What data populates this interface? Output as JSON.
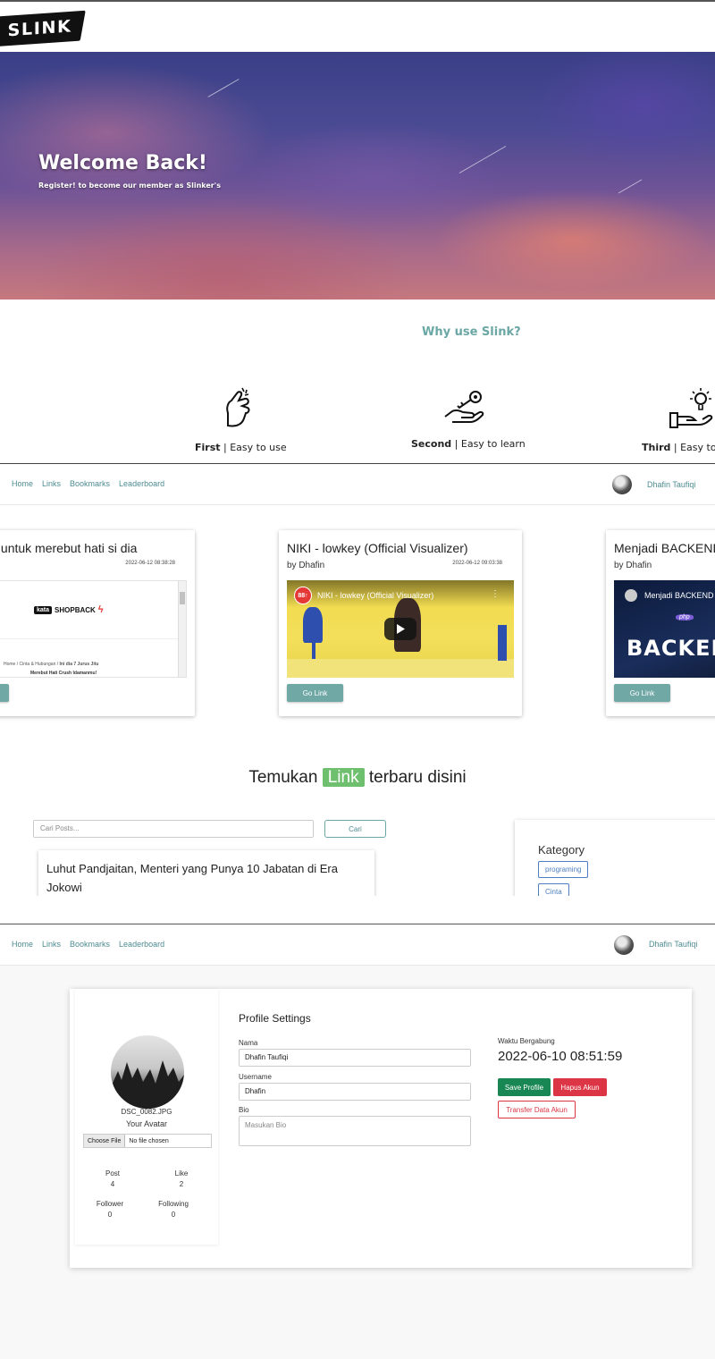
{
  "landing": {
    "logo_text": "SLINK",
    "hero": {
      "title": "Welcome Back!",
      "subtitle": "Register! to become our member as Slinker's"
    },
    "why": {
      "title": "Why use Slink?",
      "features": [
        {
          "rank": "First",
          "text": "| Easy to use",
          "icon": "hand-snap-icon"
        },
        {
          "rank": "Second",
          "text": "| Easy to learn",
          "icon": "hand-key-icon"
        },
        {
          "rank": "Third",
          "text": "| Easy to a",
          "icon": "hand-lightbulb-icon"
        }
      ]
    }
  },
  "navbar": {
    "items": [
      "Home",
      "Links",
      "Bookmarks",
      "Leaderboard"
    ],
    "user_name": "Dhafin Taufiqi"
  },
  "links": {
    "cards": [
      {
        "title": "terbaik untuk merebut hati si dia",
        "date": "2022-06-12 08:38:28",
        "author": "",
        "preview": {
          "brand": "SHOPBACK",
          "logo_text": "kata",
          "breadcrumb": "Home  /  Cinta & Hubungan  /",
          "breadcrumb_bold": "Ini dia 7 Jurus Jitu",
          "breadcrumb_line2": "Merebut Hati Crush Idamanmu!"
        }
      },
      {
        "title": "NIKI - lowkey (Official Visualizer)",
        "date": "2022-06-12 09:03:38",
        "author": "by Dhafin",
        "preview": {
          "video_title": "NIKI - lowkey (Official Visualizer)",
          "channel_badge": "88↑"
        }
      },
      {
        "title": "Menjadi BACKEND",
        "date": "",
        "author": "by Dhafin",
        "preview": {
          "video_title": "Menjadi BACKEND",
          "big_text": "BACKEND",
          "tag": "php"
        }
      }
    ],
    "go_label": "Go Link",
    "heading_before": "Temukan",
    "heading_highlight": "Link",
    "heading_after": "terbaru disini",
    "search_placeholder": "Cari Posts...",
    "search_button": "Cari",
    "post_title": "Luhut Pandjaitan, Menteri yang Punya 10 Jabatan di Era Jokowi",
    "category": {
      "title": "Kategory",
      "tags": [
        "programing",
        "Cinta"
      ]
    }
  },
  "profile": {
    "title": "Profile Settings",
    "avatar_filename": "DSC_0082.JPG",
    "avatar_caption": "Your Avatar",
    "file_button": "Choose File",
    "file_status": "No file chosen",
    "stats": [
      {
        "label": "Post",
        "value": "4"
      },
      {
        "label": "Like",
        "value": "2"
      },
      {
        "label": "Follower",
        "value": "0"
      },
      {
        "label": "Following",
        "value": "0"
      }
    ],
    "fields": {
      "nama_label": "Nama",
      "nama_value": "Dhafin Taufiqi",
      "username_label": "Username",
      "username_value": "Dhafin",
      "bio_label": "Bio",
      "bio_placeholder": "Masukan Bio"
    },
    "joined_label": "Waktu Bergabung",
    "joined_value": "2022-06-10 08:51:59",
    "buttons": {
      "save": "Save Profile",
      "delete": "Hapus Akun",
      "transfer": "Transfer Data Akun"
    }
  },
  "colors": {
    "accent_teal": "#6aa7a5",
    "nav_link": "#4d8c91",
    "highlight_green": "#6ebf6e",
    "save_green": "#198754",
    "danger_red": "#dc3545",
    "tag_blue": "#4d7fc0"
  }
}
